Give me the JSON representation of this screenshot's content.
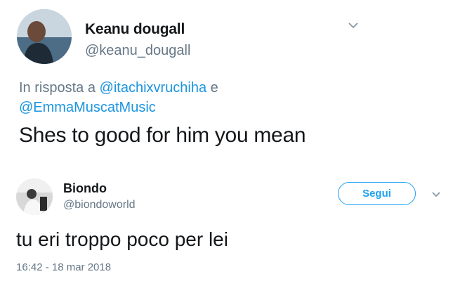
{
  "tweet": {
    "author_name": "Keanu dougall",
    "author_handle": "@keanu_dougall",
    "reply_prefix": "In risposta a ",
    "reply_mention_1": "@itachixvruchiha",
    "reply_connector": " e",
    "reply_mention_2": "@EmmaMuscatMusic",
    "text": "Shes to good for him you mean"
  },
  "reply": {
    "author_name": "Biondo",
    "author_handle": "@biondoworld",
    "follow_label": "Segui",
    "text": "tu eri troppo poco per lei",
    "timestamp": "16:42 - 18 mar 2018"
  },
  "colors": {
    "link": "#1b95e0",
    "follow_border": "#1da1f2",
    "secondary_text": "#657786"
  },
  "icons": [
    "chevron-down-icon",
    "chevron-down-icon"
  ]
}
